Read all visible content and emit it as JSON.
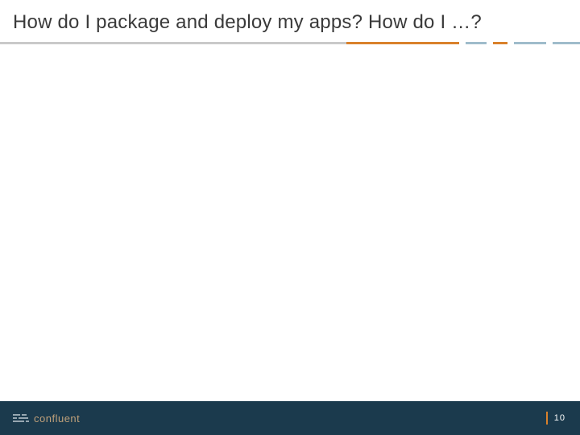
{
  "slide": {
    "title": "How do I package and deploy my apps? How do I …?"
  },
  "footer": {
    "brand": "confluent",
    "page_number": "10"
  },
  "colors": {
    "accent_orange": "#d9812b",
    "accent_blue": "#9fbccb",
    "footer_bg": "#1b3a4d",
    "title_text": "#3a3a3a"
  }
}
